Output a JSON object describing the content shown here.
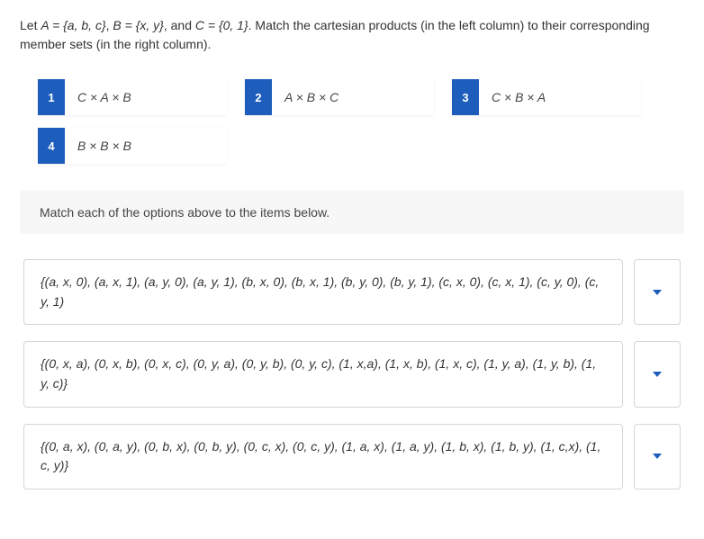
{
  "prompt": {
    "line1_prefix": "Let ",
    "setA": "A = {a, b, c}",
    "sep1": ", ",
    "setB": "B = {x, y}",
    "sep2": ", and ",
    "setC": "C = {0, 1}",
    "line1_suffix": ". Match the cartesian products (in the left column) to their corresponding member sets (in the right column)."
  },
  "options": [
    {
      "num": "1",
      "label": "C × A × B"
    },
    {
      "num": "2",
      "label": "A × B × C"
    },
    {
      "num": "3",
      "label": "C × B × A"
    },
    {
      "num": "4",
      "label": "B × B × B"
    }
  ],
  "instruction": "Match each of the options above to the items below.",
  "answers": [
    "{(a, x, 0), (a, x, 1), (a, y, 0), (a, y, 1), (b, x, 0), (b, x, 1), (b, y, 0), (b, y, 1), (c, x, 0), (c, x, 1), (c, y, 0), (c, y, 1)",
    "{(0, x, a), (0, x, b), (0, x, c), (0, y, a), (0, y, b), (0, y, c), (1, x,a), (1, x, b), (1, x, c), (1, y, a), (1, y, b), (1, y, c)}",
    "{(0, a, x), (0, a, y), (0, b, x), (0, b, y), (0, c, x), (0, c, y), (1, a, x), (1, a, y), (1, b, x), (1, b, y), (1, c,x), (1, c, y)}"
  ]
}
